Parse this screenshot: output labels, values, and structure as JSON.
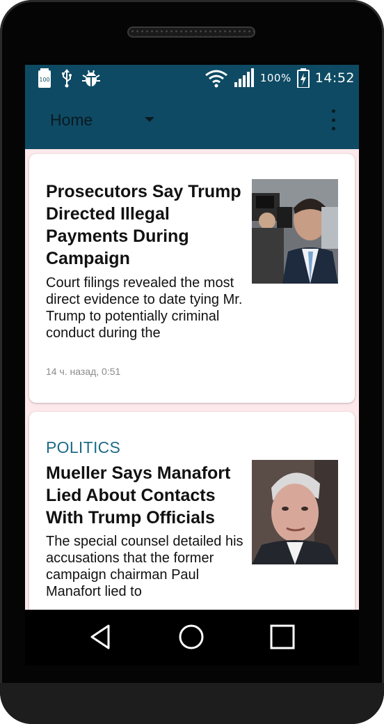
{
  "status_bar": {
    "left_icons": [
      "battery-100-icon",
      "usb-icon",
      "debug-bug-icon"
    ],
    "battery_badge": "100",
    "battery_percent": "100%",
    "time": "14:52",
    "right_icons": [
      "wifi-icon",
      "signal-icon",
      "battery-charging-icon"
    ]
  },
  "toolbar": {
    "spinner_label": "Home",
    "menu_icon": "overflow-menu-icon"
  },
  "articles": [
    {
      "section": "",
      "headline": "Prosecutors Say Trump Directed Illegal Payments During Campaign",
      "summary": "Court filings revealed the most direct evidence to date tying Mr. Trump to potentially criminal conduct during the",
      "timestamp": "14 ч. назад, 0:51",
      "thumbnail": "photo-of-man-in-suit-with-photographers"
    },
    {
      "section": "POLITICS",
      "headline": "Mueller Says Manafort Lied About Contacts With Trump Officials",
      "summary": "The special counsel detailed his accusations that the former campaign chairman Paul Manafort lied to",
      "thumbnail": "portrait-of-gray-haired-man"
    }
  ],
  "nav_bar": {
    "buttons": [
      "back-icon",
      "home-icon",
      "recents-icon"
    ]
  },
  "colors": {
    "app_bar": "#0e4a63",
    "section_label": "#1f6b87",
    "list_background": "#fde9ec"
  }
}
